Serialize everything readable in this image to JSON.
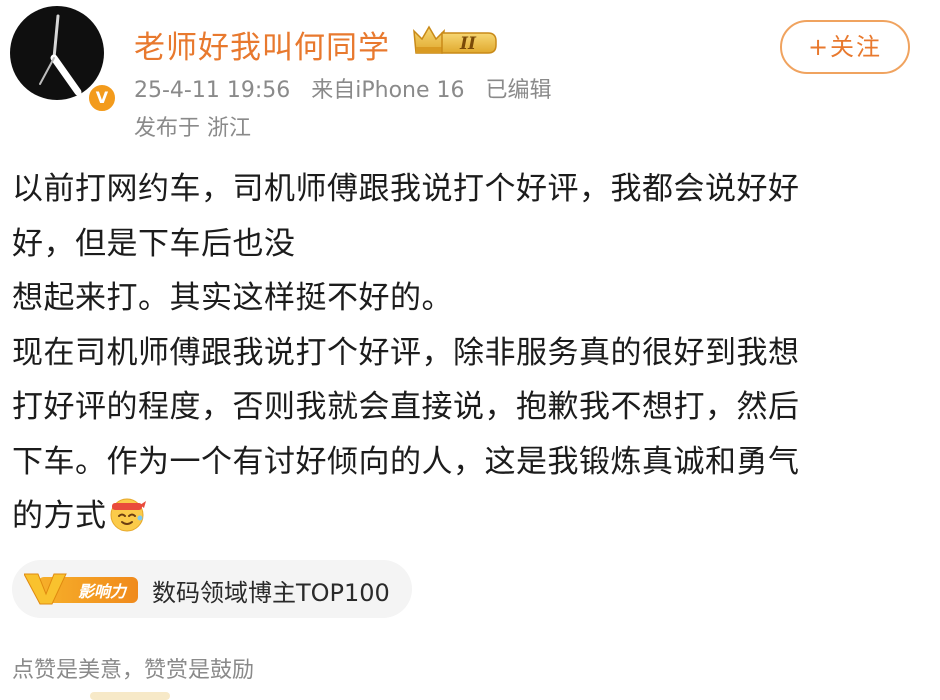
{
  "user": {
    "name": "老师好我叫何同学",
    "level_badge": "II",
    "verified_mark": "V"
  },
  "post_meta": {
    "date": "25-4-11 19:56",
    "source": "来自iPhone 16",
    "edited": "已编辑",
    "location": "发布于 浙江"
  },
  "follow_button": "+关注",
  "post": {
    "lines": [
      "以前打网约车，司机师傅跟我说打个好评，我都会说好好",
      "好，但是下车后也没",
      "想起来打。其实这样挺不好的。",
      "现在司机师傅跟我说打个好评，除非服务真的很好到我想",
      "打好评的程度，否则我就会直接说，抱歉我不想打，然后",
      "下车。作为一个有讨好倾向的人，这是我锻炼真诚和勇气",
      "的方式"
    ],
    "emoji": "effort-emoji"
  },
  "influence": {
    "tag_label": "影响力",
    "tag_letter": "V",
    "text": "数码领域博主TOP100"
  },
  "footer": {
    "reward_hint": "点赞是美意，赞赏是鼓励"
  },
  "colors": {
    "username": "#e8792e",
    "meta": "#8a8a8a",
    "body": "#1c1c1c",
    "badge_orange": "#f39b1c"
  }
}
